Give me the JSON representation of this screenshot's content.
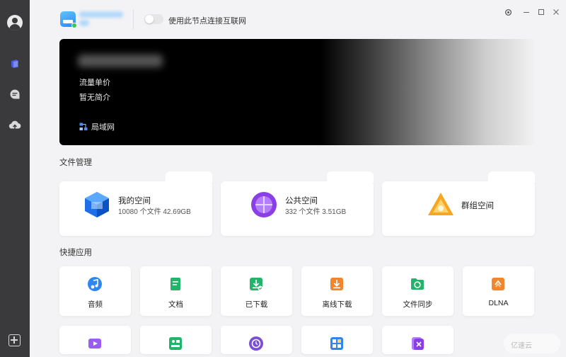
{
  "rail": {
    "items": [
      "avatar",
      "nas-icon",
      "chat-icon",
      "cloud-upload-icon"
    ],
    "add_button": "plus-icon"
  },
  "topbar": {
    "toggle_label": "使用此节点连接互联网",
    "toggle_on": false,
    "controls": [
      "settings-icon",
      "minimize-icon",
      "maximize-icon",
      "close-icon"
    ]
  },
  "banner": {
    "line1": "流量单价",
    "line2": "暂无简介",
    "network_label": "局域网"
  },
  "file_section": {
    "title": "文件管理",
    "cards": [
      {
        "title": "我的空间",
        "sub": "10080 个文件 42.69GB",
        "icon": "my-space-icon"
      },
      {
        "title": "公共空间",
        "sub": "332 个文件 3.51GB",
        "icon": "public-space-icon"
      },
      {
        "title": "群组空间",
        "sub": "",
        "icon": "group-space-icon"
      }
    ]
  },
  "apps_section": {
    "title": "快捷应用",
    "apps": [
      {
        "label": "音频",
        "icon": "music-icon"
      },
      {
        "label": "文档",
        "icon": "document-icon"
      },
      {
        "label": "已下载",
        "icon": "downloaded-icon"
      },
      {
        "label": "离线下载",
        "icon": "offline-download-icon"
      },
      {
        "label": "文件同步",
        "icon": "file-sync-icon"
      },
      {
        "label": "DLNA",
        "icon": "dlna-icon"
      }
    ],
    "apps_row2": [
      "video-icon",
      "photo-icon",
      "backup-icon",
      "apps-icon",
      "remove-icon"
    ]
  },
  "colors": {
    "rail": "#3a3a3d",
    "accent": "#2f86f0",
    "background": "#f3f3f5"
  }
}
